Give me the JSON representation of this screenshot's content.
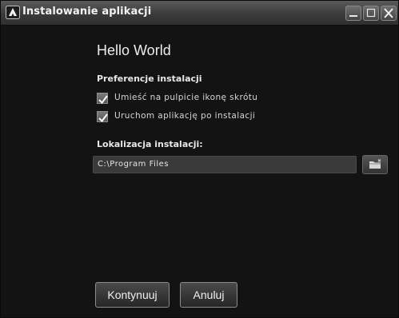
{
  "window": {
    "title": "Instalowanie aplikacji",
    "icon": "air-install-icon",
    "controls": [
      "minimize-icon",
      "maximize-icon",
      "close-icon"
    ]
  },
  "content": {
    "app_name": "Hello World",
    "preferences_label": "Preferencje instalacji",
    "options": [
      {
        "label": "Umieść na pulpicie ikonę skrótu",
        "checked": true
      },
      {
        "label": "Uruchom aplikację po instalacji",
        "checked": true
      }
    ],
    "location_label": "Lokalizacja instalacji:",
    "location_value": "C:\\Program Files",
    "browse_icon": "folder-icon"
  },
  "buttons": {
    "continue": "Kontynuuj",
    "cancel": "Anuluj"
  },
  "colors": {
    "background": "#131313",
    "titlebar": "#3b3b3b",
    "text": "#ececec",
    "field": "#3a3a3a"
  }
}
